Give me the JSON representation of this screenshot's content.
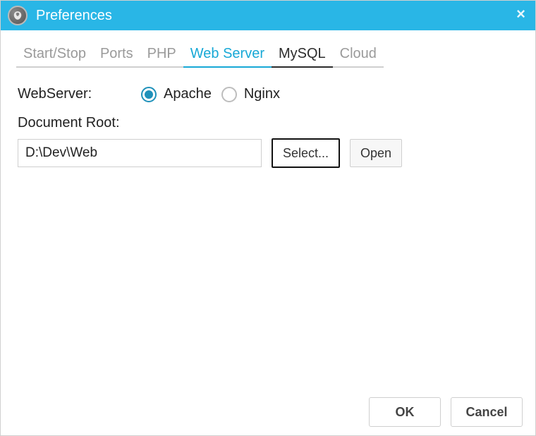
{
  "titlebar": {
    "title": "Preferences",
    "close_label": "×"
  },
  "tabs": [
    {
      "id": "start-stop",
      "label": "Start/Stop",
      "state": "normal"
    },
    {
      "id": "ports",
      "label": "Ports",
      "state": "normal"
    },
    {
      "id": "php",
      "label": "PHP",
      "state": "normal"
    },
    {
      "id": "web-server",
      "label": "Web Server",
      "state": "active"
    },
    {
      "id": "mysql",
      "label": "MySQL",
      "state": "bold"
    },
    {
      "id": "cloud",
      "label": "Cloud",
      "state": "normal"
    }
  ],
  "webserver": {
    "label": "WebServer:",
    "options": [
      {
        "id": "apache",
        "label": "Apache",
        "checked": true
      },
      {
        "id": "nginx",
        "label": "Nginx",
        "checked": false
      }
    ]
  },
  "document_root": {
    "label": "Document Root:",
    "value": "D:\\Dev\\Web",
    "select_button": "Select...",
    "open_button": "Open"
  },
  "footer": {
    "ok": "OK",
    "cancel": "Cancel"
  }
}
